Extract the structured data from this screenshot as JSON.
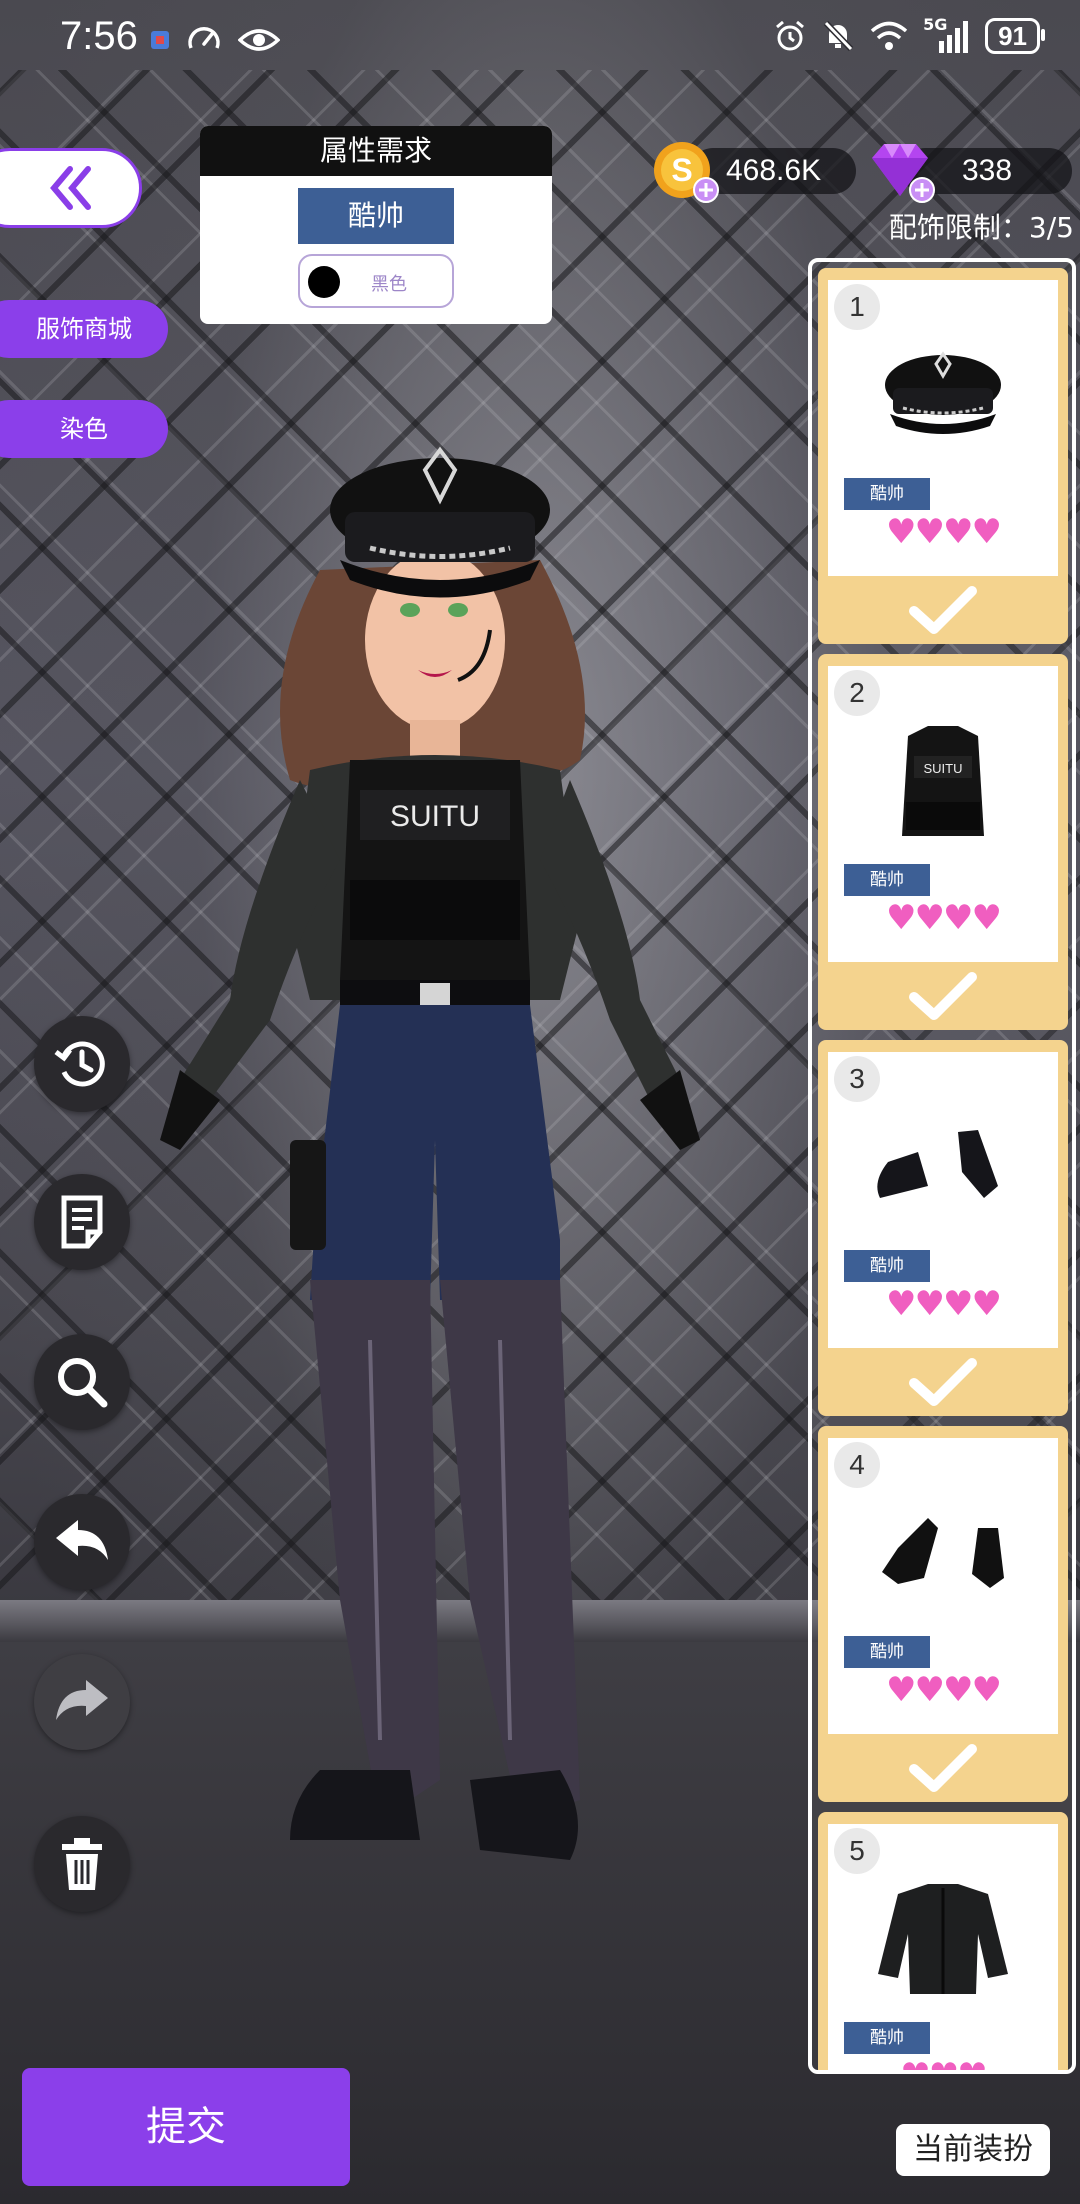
{
  "status_bar": {
    "time": "7:56",
    "network": "5G",
    "battery": "91",
    "left_icons": [
      "app-notification-icon",
      "speed-icon",
      "eye-icon"
    ],
    "right_icons": [
      "alarm-icon",
      "mute-icon",
      "wifi-icon",
      "signal-icon",
      "battery-icon"
    ]
  },
  "requirement": {
    "title": "属性需求",
    "style": "酷帅",
    "color_name": "黑色",
    "color_hex": "#000000"
  },
  "currency": {
    "coins": "468.6K",
    "gems": "338"
  },
  "accessory_limit": "配饰限制：3/5",
  "left_menu": {
    "shop": "服饰商城",
    "dye": "染色"
  },
  "tools": [
    "history-icon",
    "notes-icon",
    "search-icon",
    "undo-icon",
    "redo-icon",
    "trash-icon"
  ],
  "slots": [
    {
      "num": "1",
      "tag": "酷帅",
      "hearts": "♥♥♥♥",
      "item": "hat",
      "checked": true
    },
    {
      "num": "2",
      "tag": "酷帅",
      "hearts": "♥♥♥♥",
      "item": "vest",
      "label": "SUITU",
      "checked": true
    },
    {
      "num": "3",
      "tag": "酷帅",
      "hearts": "♥♥♥♥",
      "item": "shoes",
      "checked": true
    },
    {
      "num": "4",
      "tag": "酷帅",
      "hearts": "♥♥♥♥",
      "item": "gloves",
      "checked": true
    },
    {
      "num": "5",
      "tag": "酷帅",
      "hearts": "♥♥♥",
      "item": "jacket",
      "checked": false
    }
  ],
  "character": {
    "vest_text": "SUITU"
  },
  "buttons": {
    "submit": "提交",
    "current_outfit": "当前装扮"
  },
  "colors": {
    "accent_purple": "#8b3fea",
    "style_tag_blue": "#3d5f95",
    "slot_gold": "#f4d38e",
    "heart_pink": "#f05ec0"
  }
}
